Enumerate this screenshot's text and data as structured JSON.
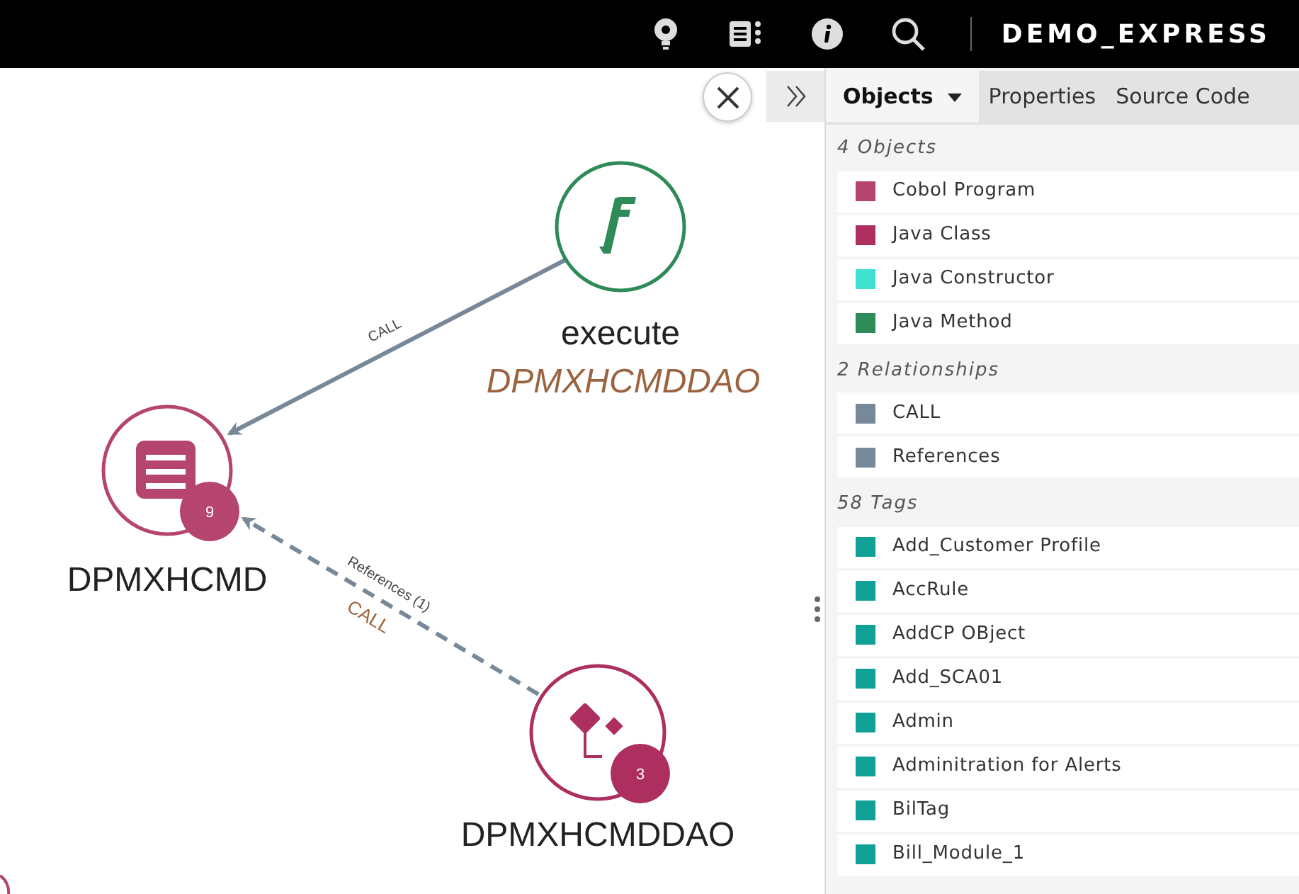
{
  "header": {
    "title": "DEMO_EXPRESS"
  },
  "graph": {
    "nodes": [
      {
        "kind": "method",
        "label": "execute",
        "sublabel": "DPMXHCMDDAO",
        "color": "#2e8b57"
      },
      {
        "kind": "program",
        "label": "DPMXHCMD",
        "color": "#b5446e",
        "count": "9"
      },
      {
        "kind": "class",
        "label": "DPMXHCMDDAO",
        "color": "#ad2f5f",
        "count": "3"
      }
    ],
    "edges": [
      {
        "kind": "solid",
        "label": "CALL"
      },
      {
        "kind": "dashed",
        "label": "References (1)",
        "sublabel": "CALL"
      }
    ]
  },
  "panel": {
    "tabs": [
      {
        "label": "Objects",
        "selected": true,
        "dropdown": true
      },
      {
        "label": "Properties",
        "selected": false
      },
      {
        "label": "Source Code",
        "selected": false
      }
    ],
    "sections": [
      {
        "title": "4 Objects",
        "items": [
          {
            "label": "Cobol Program",
            "color": "#b5446e"
          },
          {
            "label": "Java Class",
            "color": "#ad2f5f"
          },
          {
            "label": "Java Constructor",
            "color": "#40e0d0"
          },
          {
            "label": "Java Method",
            "color": "#2e8b57"
          }
        ]
      },
      {
        "title": "2 Relationships",
        "items": [
          {
            "label": "CALL",
            "color": "#778899"
          },
          {
            "label": "References",
            "color": "#778899"
          }
        ]
      },
      {
        "title": "58 Tags",
        "items": [
          {
            "label": "Add_Customer Profile",
            "color": "#0fa196"
          },
          {
            "label": "AccRule",
            "color": "#0fa196"
          },
          {
            "label": "AddCP OBject",
            "color": "#0fa196"
          },
          {
            "label": "Add_SCA01",
            "color": "#0fa196"
          },
          {
            "label": "Admin",
            "color": "#0fa196"
          },
          {
            "label": "Adminitration for Alerts",
            "color": "#0fa196"
          },
          {
            "label": "BilTag",
            "color": "#0fa196"
          },
          {
            "label": "Bill_Module_1",
            "color": "#0fa196"
          }
        ]
      }
    ]
  }
}
